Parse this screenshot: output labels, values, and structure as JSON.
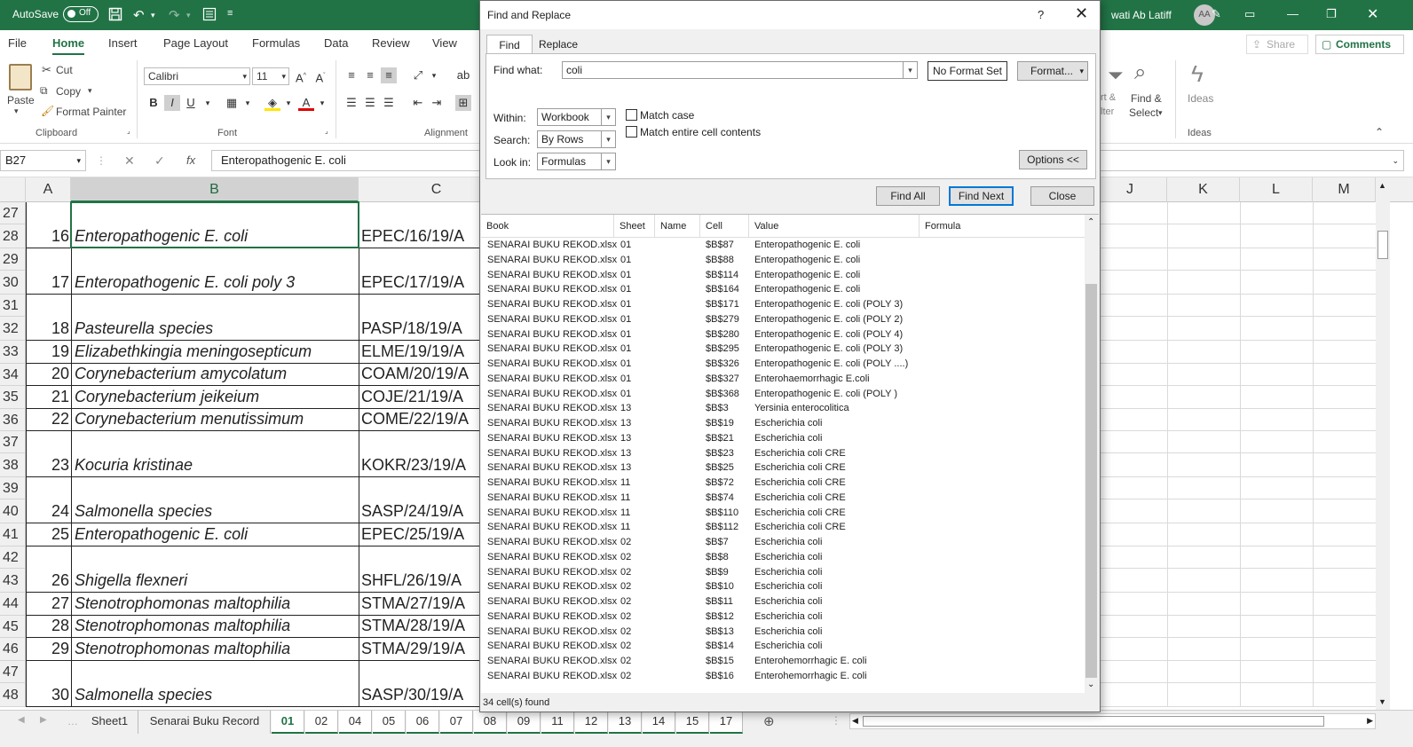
{
  "titlebar": {
    "autosave": "AutoSave",
    "toggle": "Off",
    "user": "wati Ab Latiff",
    "avatar": "AA"
  },
  "menu": [
    "File",
    "Home",
    "Insert",
    "Page Layout",
    "Formulas",
    "Data",
    "Review",
    "View"
  ],
  "share": "Share",
  "comments": "Comments",
  "ribbon": {
    "paste": "Paste",
    "cut": "Cut",
    "copy": "Copy",
    "format_painter": "Format Painter",
    "clipboard": "Clipboard",
    "font_name": "Calibri",
    "font_size": "11",
    "font_group": "Font",
    "alignment_group": "Alignment",
    "sort_partial": "rt &",
    "filter_partial": "lter",
    "find_select": "Find &",
    "select": "Select",
    "ideas": "Ideas",
    "ideas_group": "Ideas"
  },
  "formulabar": {
    "namebox": "B27",
    "formula": "Enteropathogenic E. coli"
  },
  "columns": {
    "a": "A",
    "b": "B",
    "c": "C",
    "j": "J",
    "k": "K",
    "l": "L",
    "m": "M"
  },
  "rows": [
    {
      "num": "27"
    },
    {
      "num": "28",
      "a": "16",
      "b": "Enteropathogenic E. coli",
      "c": "EPEC/16/19/A"
    },
    {
      "num": "29"
    },
    {
      "num": "30",
      "a": "17",
      "b": "Enteropathogenic E. coli poly 3",
      "c": "EPEC/17/19/A"
    },
    {
      "num": "31"
    },
    {
      "num": "32",
      "a": "18",
      "b": "Pasteurella species",
      "c": "PASP/18/19/A"
    },
    {
      "num": "33",
      "a": "19",
      "b": "Elizabethkingia meningosepticum",
      "c": "ELME/19/19/A"
    },
    {
      "num": "34",
      "a": "20",
      "b": "Corynebacterium amycolatum",
      "c": "COAM/20/19/A"
    },
    {
      "num": "35",
      "a": "21",
      "b": "Corynebacterium jeikeium",
      "c": "COJE/21/19/A"
    },
    {
      "num": "36",
      "a": "22",
      "b": "Corynebacterium menutissimum",
      "c": "COME/22/19/A"
    },
    {
      "num": "37"
    },
    {
      "num": "38",
      "a": "23",
      "b": "Kocuria kristinae",
      "c": "KOKR/23/19/A"
    },
    {
      "num": "39"
    },
    {
      "num": "40",
      "a": "24",
      "b": "Salmonella species",
      "c": "SASP/24/19/A"
    },
    {
      "num": "41",
      "a": "25",
      "b": "Enteropathogenic E. coli",
      "c": "EPEC/25/19/A"
    },
    {
      "num": "42"
    },
    {
      "num": "43",
      "a": "26",
      "b": "Shigella flexneri",
      "c": "SHFL/26/19/A"
    },
    {
      "num": "44",
      "a": "27",
      "b": "Stenotrophomonas maltophilia",
      "c": "STMA/27/19/A"
    },
    {
      "num": "45",
      "a": "28",
      "b": "Stenotrophomonas maltophilia",
      "c": "STMA/28/19/A"
    },
    {
      "num": "46",
      "a": "29",
      "b": "Stenotrophomonas maltophilia",
      "c": "STMA/29/19/A"
    },
    {
      "num": "47"
    },
    {
      "num": "48",
      "a": "30",
      "b": "Salmonella species",
      "c": "SASP/30/19/A"
    }
  ],
  "sheets": [
    "Sheet1",
    "Senarai Buku Record",
    "01",
    "02",
    "04",
    "05",
    "06",
    "07",
    "08",
    "09",
    "11",
    "12",
    "13",
    "14",
    "15",
    "17"
  ],
  "dialog": {
    "title": "Find and Replace",
    "help": "?",
    "tab_find": "Find",
    "tab_replace": "Replace",
    "find_what_label": "Find what:",
    "find_what_value": "coli",
    "no_format": "No Format Set",
    "format_btn": "Format...",
    "within_label": "Within:",
    "within_value": "Workbook",
    "search_label": "Search:",
    "search_value": "By Rows",
    "lookin_label": "Look in:",
    "lookin_value": "Formulas",
    "match_case": "Match case",
    "match_entire": "Match entire cell contents",
    "options_btn": "Options <<",
    "find_all": "Find All",
    "find_next": "Find Next",
    "close": "Close",
    "headers": {
      "book": "Book",
      "sheet": "Sheet",
      "name": "Name",
      "cell": "Cell",
      "value": "Value",
      "formula": "Formula"
    },
    "status": "34 cell(s) found",
    "results": [
      {
        "book": "SENARAI BUKU REKOD.xlsx",
        "sheet": "01",
        "cell": "$B$87",
        "value": "Enteropathogenic E. coli"
      },
      {
        "book": "SENARAI BUKU REKOD.xlsx",
        "sheet": "01",
        "cell": "$B$88",
        "value": "Enteropathogenic E. coli"
      },
      {
        "book": "SENARAI BUKU REKOD.xlsx",
        "sheet": "01",
        "cell": "$B$114",
        "value": "Enteropathogenic E. coli"
      },
      {
        "book": "SENARAI BUKU REKOD.xlsx",
        "sheet": "01",
        "cell": "$B$164",
        "value": "Enteropathogenic E. coli"
      },
      {
        "book": "SENARAI BUKU REKOD.xlsx",
        "sheet": "01",
        "cell": "$B$171",
        "value": "Enteropathogenic E. coli (POLY 3)"
      },
      {
        "book": "SENARAI BUKU REKOD.xlsx",
        "sheet": "01",
        "cell": "$B$279",
        "value": "Enteropathogenic E. coli (POLY 2)"
      },
      {
        "book": "SENARAI BUKU REKOD.xlsx",
        "sheet": "01",
        "cell": "$B$280",
        "value": "Enteropathogenic E. coli (POLY 4)"
      },
      {
        "book": "SENARAI BUKU REKOD.xlsx",
        "sheet": "01",
        "cell": "$B$295",
        "value": "Enteropathogenic E. coli (POLY 3)"
      },
      {
        "book": "SENARAI BUKU REKOD.xlsx",
        "sheet": "01",
        "cell": "$B$326",
        "value": "Enteropathogenic E. coli (POLY ....)"
      },
      {
        "book": "SENARAI BUKU REKOD.xlsx",
        "sheet": "01",
        "cell": "$B$327",
        "value": "Enterohaemorrhagic E.coli"
      },
      {
        "book": "SENARAI BUKU REKOD.xlsx",
        "sheet": "01",
        "cell": "$B$368",
        "value": "Enteropathogenic E. coli (POLY )"
      },
      {
        "book": "SENARAI BUKU REKOD.xlsx",
        "sheet": "13",
        "cell": "$B$3",
        "value": "Yersinia enterocolitica"
      },
      {
        "book": "SENARAI BUKU REKOD.xlsx",
        "sheet": "13",
        "cell": "$B$19",
        "value": "Escherichia coli"
      },
      {
        "book": "SENARAI BUKU REKOD.xlsx",
        "sheet": "13",
        "cell": "$B$21",
        "value": "Escherichia coli"
      },
      {
        "book": "SENARAI BUKU REKOD.xlsx",
        "sheet": "13",
        "cell": "$B$23",
        "value": "Escherichia coli CRE"
      },
      {
        "book": "SENARAI BUKU REKOD.xlsx",
        "sheet": "13",
        "cell": "$B$25",
        "value": "Escherichia coli CRE"
      },
      {
        "book": "SENARAI BUKU REKOD.xlsx",
        "sheet": "11",
        "cell": "$B$72",
        "value": "Escherichia coli CRE"
      },
      {
        "book": "SENARAI BUKU REKOD.xlsx",
        "sheet": "11",
        "cell": "$B$74",
        "value": "Escherichia coli CRE"
      },
      {
        "book": "SENARAI BUKU REKOD.xlsx",
        "sheet": "11",
        "cell": "$B$110",
        "value": "Escherichia coli CRE"
      },
      {
        "book": "SENARAI BUKU REKOD.xlsx",
        "sheet": "11",
        "cell": "$B$112",
        "value": "Escherichia coli CRE"
      },
      {
        "book": "SENARAI BUKU REKOD.xlsx",
        "sheet": "02",
        "cell": "$B$7",
        "value": "Escherichia coli"
      },
      {
        "book": "SENARAI BUKU REKOD.xlsx",
        "sheet": "02",
        "cell": "$B$8",
        "value": "Escherichia coli"
      },
      {
        "book": "SENARAI BUKU REKOD.xlsx",
        "sheet": "02",
        "cell": "$B$9",
        "value": "Escherichia coli"
      },
      {
        "book": "SENARAI BUKU REKOD.xlsx",
        "sheet": "02",
        "cell": "$B$10",
        "value": "Escherichia coli"
      },
      {
        "book": "SENARAI BUKU REKOD.xlsx",
        "sheet": "02",
        "cell": "$B$11",
        "value": "Escherichia coli"
      },
      {
        "book": "SENARAI BUKU REKOD.xlsx",
        "sheet": "02",
        "cell": "$B$12",
        "value": "Escherichia coli"
      },
      {
        "book": "SENARAI BUKU REKOD.xlsx",
        "sheet": "02",
        "cell": "$B$13",
        "value": "Escherichia coli"
      },
      {
        "book": "SENARAI BUKU REKOD.xlsx",
        "sheet": "02",
        "cell": "$B$14",
        "value": "Escherichia coli"
      },
      {
        "book": "SENARAI BUKU REKOD.xlsx",
        "sheet": "02",
        "cell": "$B$15",
        "value": "Enterohemorrhagic E. coli"
      },
      {
        "book": "SENARAI BUKU REKOD.xlsx",
        "sheet": "02",
        "cell": "$B$16",
        "value": "Enterohemorrhagic E. coli"
      }
    ]
  }
}
